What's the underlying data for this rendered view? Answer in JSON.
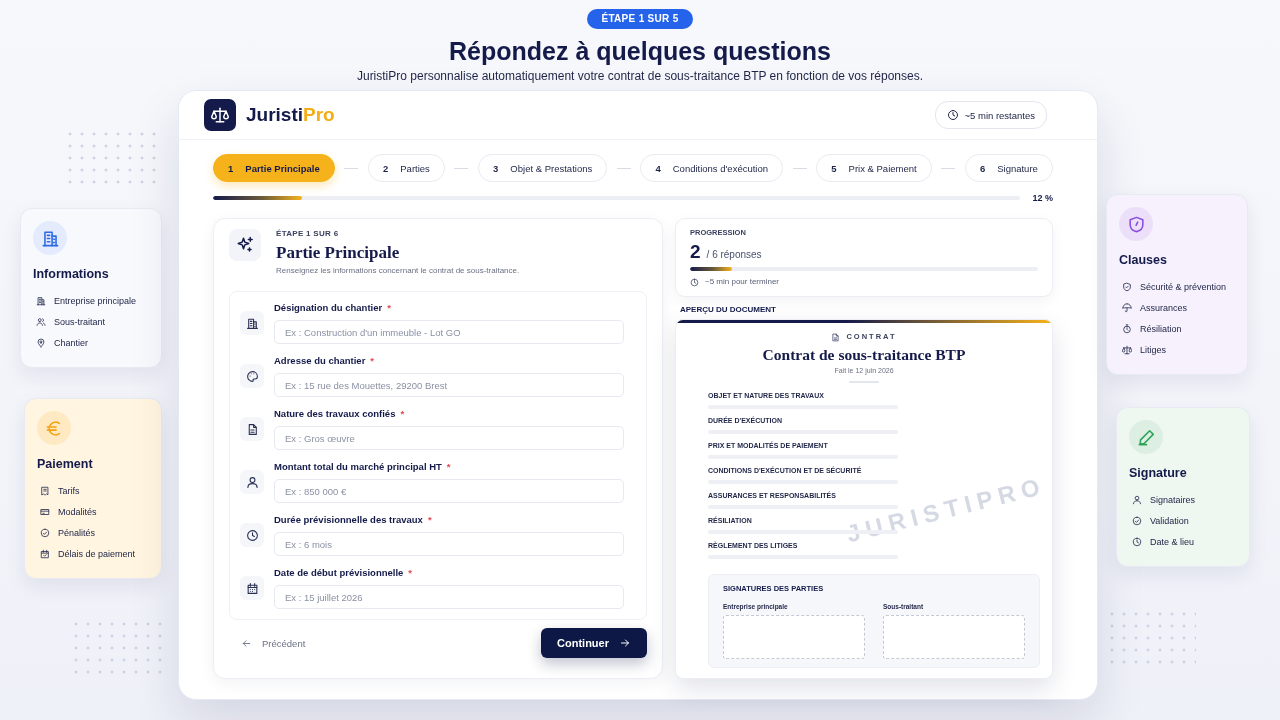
{
  "header": {
    "badge": "ÉTAPE 1 SUR 5",
    "title": "Répondez à quelques questions",
    "subtitle": "JuristiPro personnalise automatiquement votre contrat de sous-traitance BTP en fonction de vos réponses."
  },
  "side_cards_left": [
    {
      "title": "Informations",
      "items": [
        "Entreprise principale",
        "Sous-traitant",
        "Chantier"
      ]
    },
    {
      "title": "Paiement",
      "items": [
        "Tarifs",
        "Modalités",
        "Pénalités",
        "Délais de paiement"
      ]
    }
  ],
  "app": {
    "logo": {
      "name": "Juristi",
      "accent": "Pro"
    },
    "time_chip": "~5 min restantes",
    "steps": [
      {
        "number": "1",
        "label": "Partie Principale",
        "selected": true
      },
      {
        "number": "2",
        "label": "Parties",
        "selected": false
      },
      {
        "number": "3",
        "label": "Objet & Prestations",
        "selected": false
      },
      {
        "number": "4",
        "label": "Conditions d'exécution",
        "selected": false
      },
      {
        "number": "5",
        "label": "Prix & Paiement",
        "selected": false
      },
      {
        "number": "6",
        "label": "Signature",
        "selected": false
      }
    ],
    "progress": {
      "level": 0.11,
      "reading": "12 %"
    },
    "form": {
      "eyebrow": "ÉTAPE 1 SUR 6",
      "title": "Partie Principale",
      "description": "Renseignez les informations concernant le contrat de sous-traitance.",
      "fields": [
        {
          "label": "Désignation du chantier",
          "mark": "*",
          "placeholder": "Ex : Construction d'un immeuble - Lot GO"
        },
        {
          "label": "Adresse du chantier",
          "mark": "*",
          "placeholder": "Ex : 15 rue des Mouettes, 29200 Brest"
        },
        {
          "label": "Nature des travaux confiés",
          "mark": "*",
          "placeholder": "Ex : Gros œuvre"
        },
        {
          "label": "Montant total du marché principal HT",
          "mark": "*",
          "placeholder": "Ex : 850 000 €"
        },
        {
          "label": "Durée prévisionnelle des travaux",
          "mark": "*",
          "placeholder": "Ex : 6 mois"
        },
        {
          "label": "Date de début prévisionnelle",
          "mark": "*",
          "placeholder": "Ex : 15 juillet 2026"
        }
      ],
      "back_link": "Précédent",
      "next_button": "Continuer"
    },
    "progression": {
      "title": "PROGRESSION",
      "count": "2",
      "total": "/ 6 réponses",
      "level": 0.12,
      "eta": "~5 min pour terminer"
    },
    "preview": {
      "label": "APERÇU DU DOCUMENT",
      "kicker": "CONTRAT",
      "title": "Contrat de sous-traitance BTP",
      "date": "Fait le 12 juin 2026",
      "sections": [
        "OBJET ET NATURE DES TRAVAUX",
        "DURÉE D'EXÉCUTION",
        "PRIX ET MODALITÉS DE PAIEMENT",
        "CONDITIONS D'EXÉCUTION ET DE SÉCURITÉ",
        "ASSURANCES ET RESPONSABILITÉS",
        "RÉSILIATION",
        "RÈGLEMENT DES LITIGES"
      ],
      "watermark": "JURISTIPRO",
      "signatures": {
        "title": "SIGNATURES DES PARTIES",
        "parties": [
          "Entreprise principale",
          "Sous-traitant"
        ]
      }
    }
  },
  "side_cards_right": [
    {
      "title": "Clauses",
      "items": [
        "Sécurité & prévention",
        "Assurances",
        "Résiliation",
        "Litiges"
      ]
    },
    {
      "title": "Signature",
      "items": [
        "Signataires",
        "Validation",
        "Date & lieu"
      ]
    }
  ]
}
